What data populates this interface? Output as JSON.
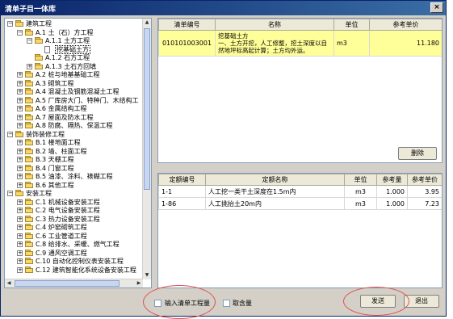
{
  "window": {
    "title": "清单子目一体库",
    "close_label": "×"
  },
  "tree": [
    {
      "label": "建筑工程",
      "level": 0,
      "exp": "−",
      "icon": "folder"
    },
    {
      "label": "A.1 土（石）方工程",
      "level": 1,
      "exp": "−",
      "icon": "folder"
    },
    {
      "label": "A.1.1 土方工程",
      "level": 2,
      "exp": "−",
      "icon": "folder"
    },
    {
      "label": "挖基础土方",
      "level": 3,
      "exp": "",
      "icon": "doc",
      "selected": true
    },
    {
      "label": "A.1.2 石方工程",
      "level": 2,
      "exp": "",
      "icon": "folder"
    },
    {
      "label": "A.1.3 土石方回填",
      "level": 2,
      "exp": "+",
      "icon": "folder"
    },
    {
      "label": "A.2 桩与地基基础工程",
      "level": 1,
      "exp": "+",
      "icon": "folder"
    },
    {
      "label": "A.3 砌筑工程",
      "level": 1,
      "exp": "+",
      "icon": "folder"
    },
    {
      "label": "A.4 混凝土及钢筋混凝土工程",
      "level": 1,
      "exp": "+",
      "icon": "folder"
    },
    {
      "label": "A.5 厂库房大门、特种门、木结构工",
      "level": 1,
      "exp": "+",
      "icon": "folder"
    },
    {
      "label": "A.6 金属结构工程",
      "level": 1,
      "exp": "+",
      "icon": "folder"
    },
    {
      "label": "A.7 屋面及防水工程",
      "level": 1,
      "exp": "+",
      "icon": "folder"
    },
    {
      "label": "A.8 防腐、隔热、保温工程",
      "level": 1,
      "exp": "+",
      "icon": "folder"
    },
    {
      "label": "装饰装修工程",
      "level": 0,
      "exp": "−",
      "icon": "folder"
    },
    {
      "label": "B.1 楼地面工程",
      "level": 1,
      "exp": "+",
      "icon": "folder"
    },
    {
      "label": "B.2 墙、柱面工程",
      "level": 1,
      "exp": "+",
      "icon": "folder"
    },
    {
      "label": "B.3 天棚工程",
      "level": 1,
      "exp": "+",
      "icon": "folder"
    },
    {
      "label": "B.4 门窗工程",
      "level": 1,
      "exp": "+",
      "icon": "folder"
    },
    {
      "label": "B.5 油漆、涂料、裱糊工程",
      "level": 1,
      "exp": "+",
      "icon": "folder"
    },
    {
      "label": "B.6 其他工程",
      "level": 1,
      "exp": "+",
      "icon": "folder"
    },
    {
      "label": "安装工程",
      "level": 0,
      "exp": "−",
      "icon": "folder"
    },
    {
      "label": "C.1 机械设备安装工程",
      "level": 1,
      "exp": "+",
      "icon": "folder"
    },
    {
      "label": "C.2 电气设备安装工程",
      "level": 1,
      "exp": "+",
      "icon": "folder"
    },
    {
      "label": "C.3 热力设备安装工程",
      "level": 1,
      "exp": "+",
      "icon": "folder"
    },
    {
      "label": "C.4 炉窑砌筑工程",
      "level": 1,
      "exp": "+",
      "icon": "folder"
    },
    {
      "label": "C.6 工业管道工程",
      "level": 1,
      "exp": "+",
      "icon": "folder"
    },
    {
      "label": "C.8 给排水、采暖、燃气工程",
      "level": 1,
      "exp": "+",
      "icon": "folder"
    },
    {
      "label": "C.9 通风空调工程",
      "level": 1,
      "exp": "+",
      "icon": "folder"
    },
    {
      "label": "C.10 自动化控制仪表安装工程",
      "level": 1,
      "exp": "+",
      "icon": "folder"
    },
    {
      "label": "C.12 建筑智能化系统设备安装工程",
      "level": 1,
      "exp": "+",
      "icon": "folder"
    }
  ],
  "top_table": {
    "headers": [
      "清单编号",
      "名称",
      "单位",
      "参考单价"
    ],
    "rows": [
      {
        "code": "010101003001",
        "name": "挖基础土方\n一、土方开挖，人工修整，挖土深度以自然地坪标高起计算；土方均外运。",
        "unit": "m3",
        "price": "11.180"
      }
    ]
  },
  "delete_button": "删除",
  "bottom_table": {
    "headers": [
      "定额编号",
      "定额名称",
      "单位",
      "参考量",
      "参考单价"
    ],
    "rows": [
      {
        "code": "1-1",
        "name": "人工挖一类干土深度在1.5m内",
        "unit": "m3",
        "qty": "1.000",
        "price": "3.95"
      },
      {
        "code": "1-86",
        "name": "人工挑抬土20m内",
        "unit": "m3",
        "qty": "1.000",
        "price": "7.23"
      }
    ]
  },
  "footer": {
    "input_qty_label": "输入清单工程量",
    "take_qty_label": "取含量",
    "send_button": "发送",
    "exit_button": "退出"
  }
}
